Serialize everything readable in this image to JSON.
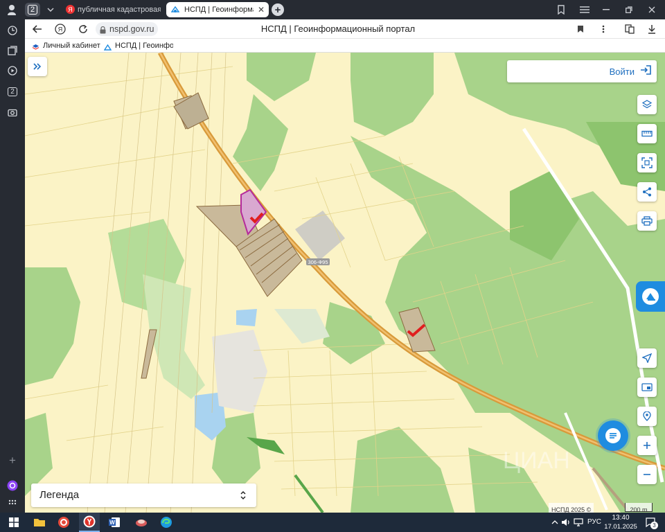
{
  "browser": {
    "profile_badge": "2",
    "tabs": [
      {
        "title": "публичная кадастровая к",
        "favicon": "Я",
        "active": false
      },
      {
        "title": "НСПД | Геоинформаци",
        "active": true
      }
    ],
    "address_bar": {
      "url": "nspd.gov.ru",
      "page_title": "НСПД | Геоинформационный портал"
    },
    "bookmarks": [
      {
        "label": "Личный кабинет"
      },
      {
        "label": "НСПД | Геоинфор"
      }
    ],
    "sidebar_badge": "2"
  },
  "map": {
    "login_button": "Войти",
    "road_label": "306-Ф95",
    "legend_label": "Легенда",
    "attribution": "НСПД 2025 ©",
    "scale_label": "200 m",
    "watermark": "ЦИАН",
    "colors": {
      "field": "#fbf3c6",
      "forest": "#a8d38a",
      "forest_dark": "#8dc46e",
      "parcel": "#c9b99a",
      "highway": "#d89a3a",
      "selected": "#b52a9a",
      "water": "#a9d3f0",
      "accent": "#1f8ce0"
    },
    "tools": [
      "layers-icon",
      "ruler-icon",
      "select-area-icon",
      "share-icon",
      "print-icon"
    ],
    "nav_tools": [
      "locate-icon",
      "minimap-icon",
      "geo-search-icon",
      "zoom-in-icon",
      "zoom-out-icon"
    ]
  },
  "taskbar": {
    "time": "13:40",
    "date": "17.01.2025",
    "language": "РУС",
    "notification_count": "3"
  }
}
